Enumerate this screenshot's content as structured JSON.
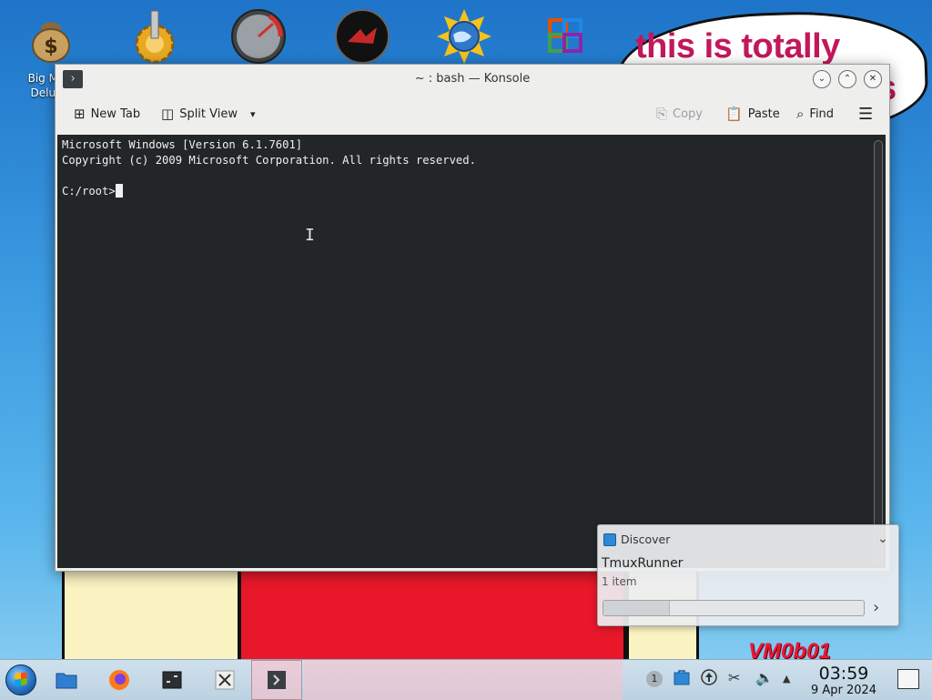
{
  "desktop": {
    "icons": [
      {
        "name": "money-bag-icon",
        "label": "Big M... Delu..."
      },
      {
        "name": "gear-icon"
      },
      {
        "name": "speedometer-icon"
      },
      {
        "name": "red-disc-icon"
      },
      {
        "name": "globe-sun-icon"
      },
      {
        "name": "office-icon"
      }
    ],
    "bubble_text": "this is totally",
    "watermark": "VM0b01"
  },
  "window": {
    "title": "~ : bash — Konsole",
    "controls": {
      "minimize": "⌄",
      "maximize": "⌃",
      "close": "✕"
    },
    "toolbar": {
      "new_tab": "New Tab",
      "split_view": "Split View",
      "copy": "Copy",
      "paste": "Paste",
      "find": "Find"
    },
    "terminal": {
      "line1": "Microsoft Windows [Version 6.1.7601]",
      "line2": "Copyright (c) 2009 Microsoft Corporation. All rights reserved.",
      "prompt": "C:/root>"
    }
  },
  "notification": {
    "app": "Discover",
    "title": "TmuxRunner",
    "subtitle": "1 item",
    "progress_fraction": 0.25
  },
  "taskbar": {
    "items": [
      "start-button",
      "file-manager",
      "firefox",
      "terminal",
      "x-app",
      "konsole"
    ],
    "tray_badge": "1",
    "clock_time": "03:59",
    "clock_date": "9 Apr 2024"
  },
  "colors": {
    "accent_text": "#c2185b",
    "terminal_bg": "#232627"
  }
}
